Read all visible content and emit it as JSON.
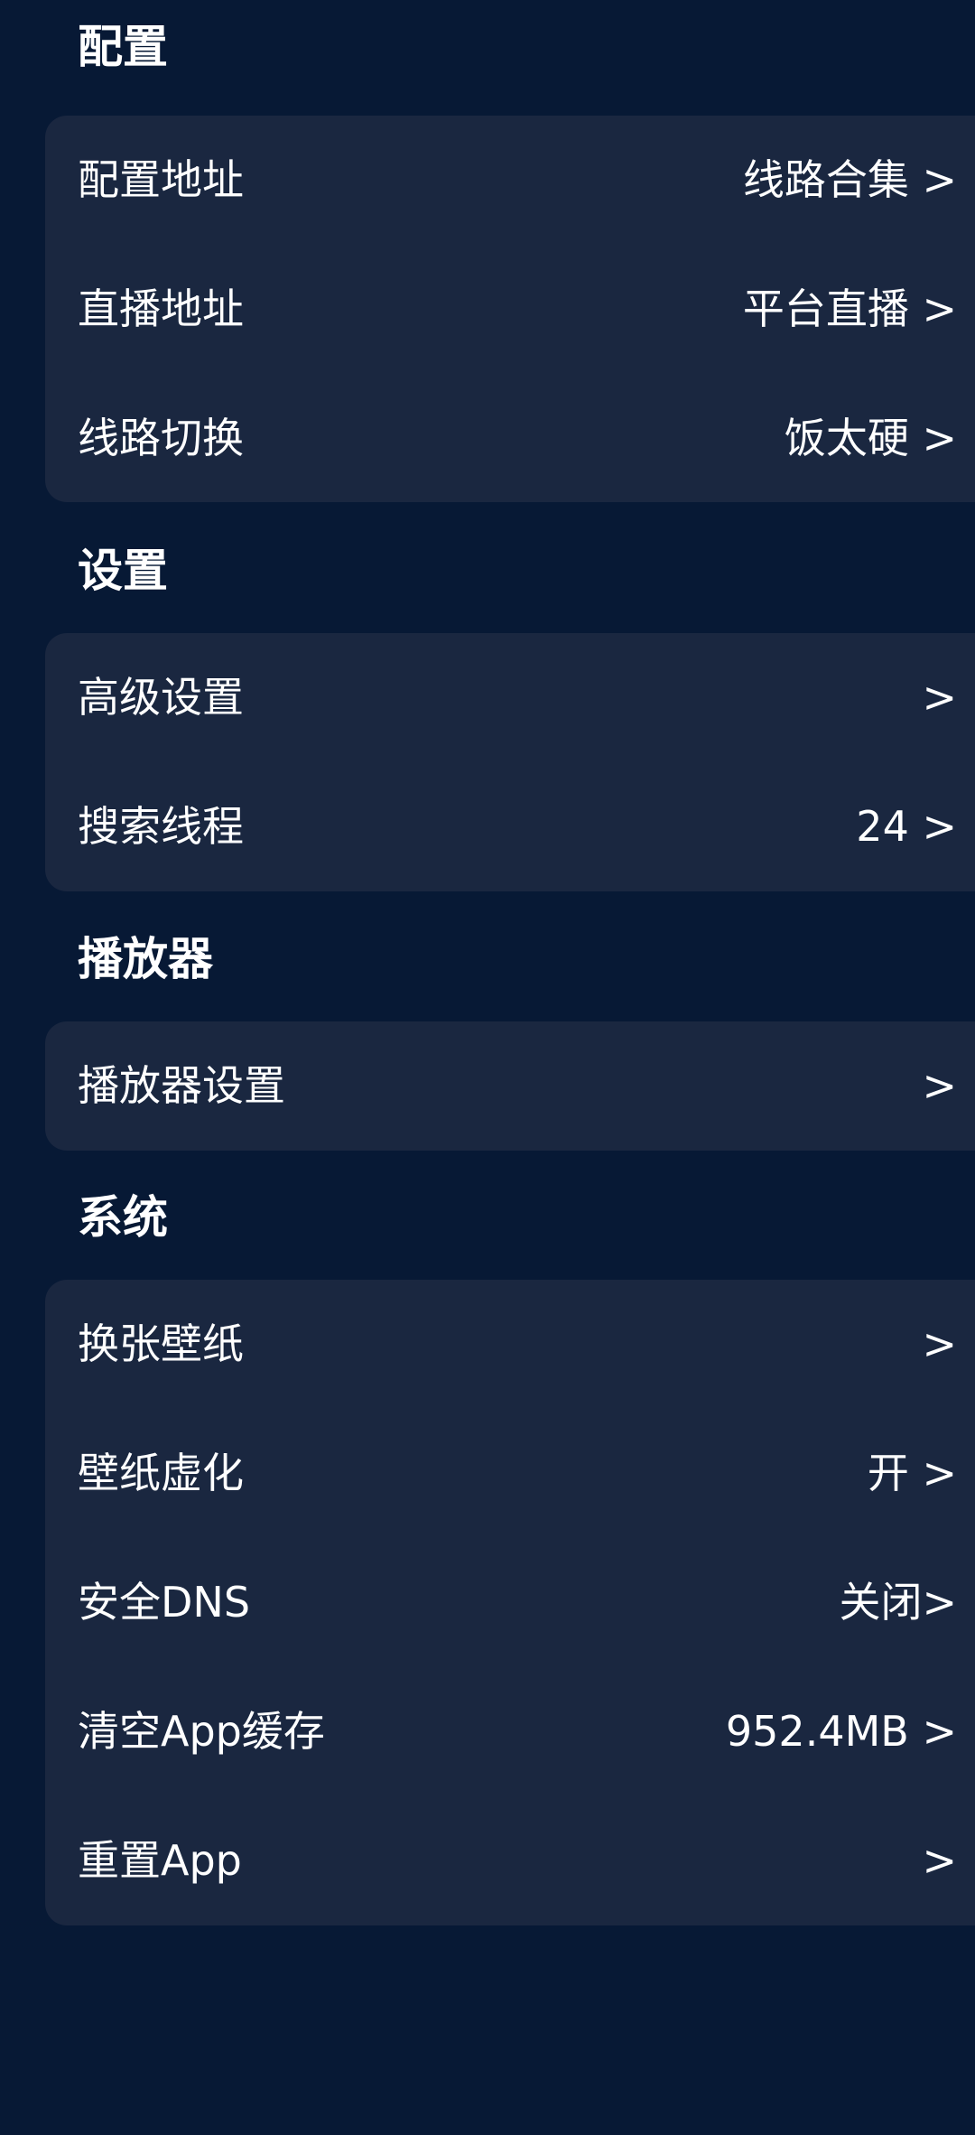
{
  "sections": [
    {
      "title": "配置",
      "rows": [
        {
          "label": "配置地址",
          "value": "线路合集 >"
        },
        {
          "label": "直播地址",
          "value": "平台直播 >"
        },
        {
          "label": "线路切换",
          "value": "饭太硬 >"
        }
      ]
    },
    {
      "title": "设置",
      "rows": [
        {
          "label": "高级设置",
          "value": ">"
        },
        {
          "label": "搜索线程",
          "value": "24 >"
        }
      ]
    },
    {
      "title": "播放器",
      "rows": [
        {
          "label": "播放器设置",
          "value": ">"
        }
      ]
    },
    {
      "title": "系统",
      "rows": [
        {
          "label": "换张壁纸",
          "value": ">"
        },
        {
          "label": "壁纸虚化",
          "value": "开 >"
        },
        {
          "label": "安全DNS",
          "value": "关闭>"
        },
        {
          "label": "清空App缓存",
          "value": "952.4MB >"
        },
        {
          "label": "重置App",
          "value": ">"
        }
      ]
    }
  ],
  "colors": {
    "background": "#071935",
    "card": "#1a2740",
    "text": "#ffffff"
  }
}
